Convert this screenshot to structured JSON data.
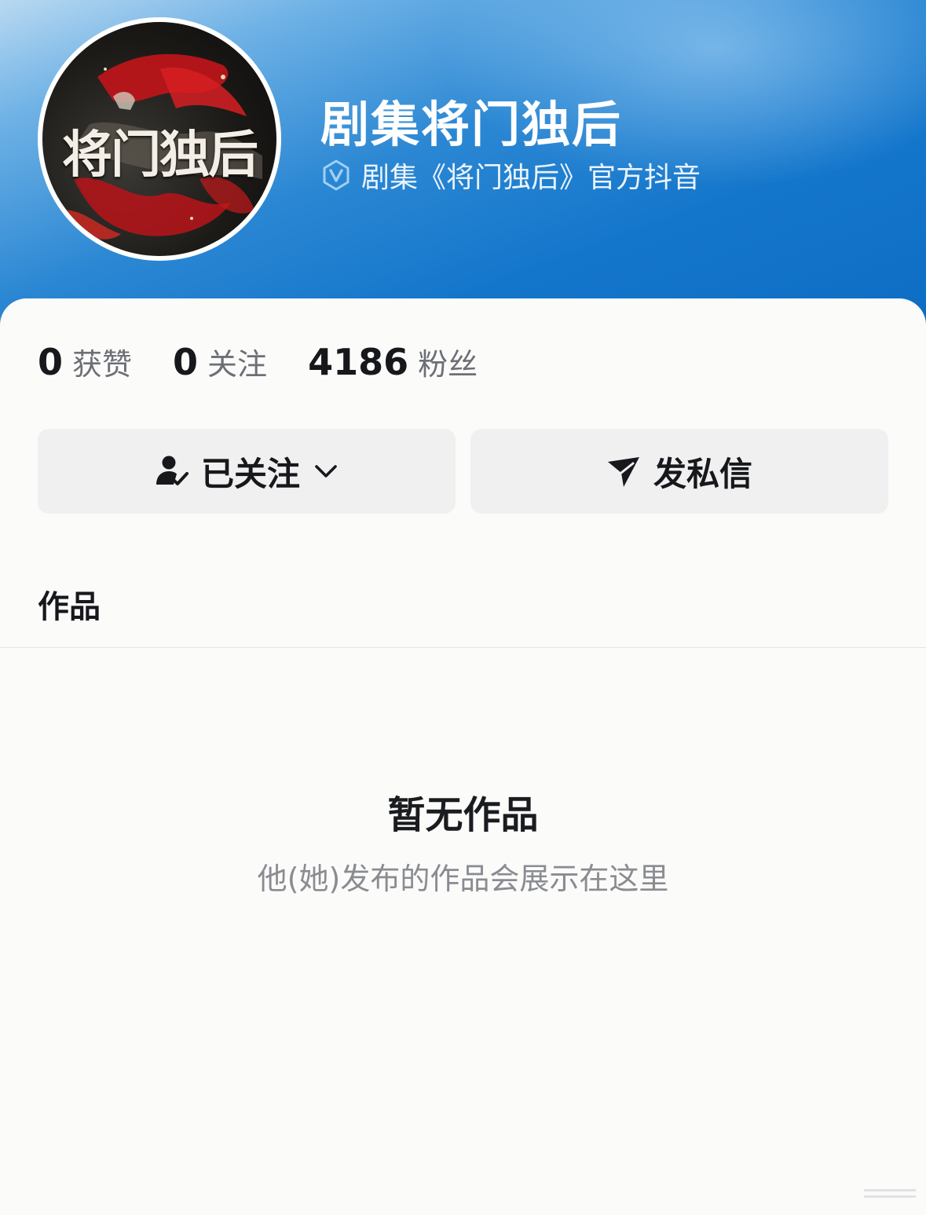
{
  "profile": {
    "name": "剧集将门独后",
    "verification": "剧集《将门独后》官方抖音",
    "avatar_text": "将门独后"
  },
  "stats": [
    {
      "value": "0",
      "label": "获赞"
    },
    {
      "value": "0",
      "label": "关注"
    },
    {
      "value": "4186",
      "label": "粉丝"
    }
  ],
  "actions": {
    "follow_label": "已关注",
    "message_label": "发私信"
  },
  "tabs": {
    "works_label": "作品"
  },
  "empty_state": {
    "title": "暂无作品",
    "subtitle": "他(她)发布的作品会展示在这里"
  },
  "icons": {
    "verify": "verified-badge-icon",
    "follow": "user-check-icon",
    "dropdown": "chevron-down-icon",
    "message": "send-icon"
  },
  "colors": {
    "header_blue": "#1476cb",
    "text_primary": "#17181c",
    "text_secondary": "#6d6f76",
    "button_bg": "#f0f0f1"
  }
}
